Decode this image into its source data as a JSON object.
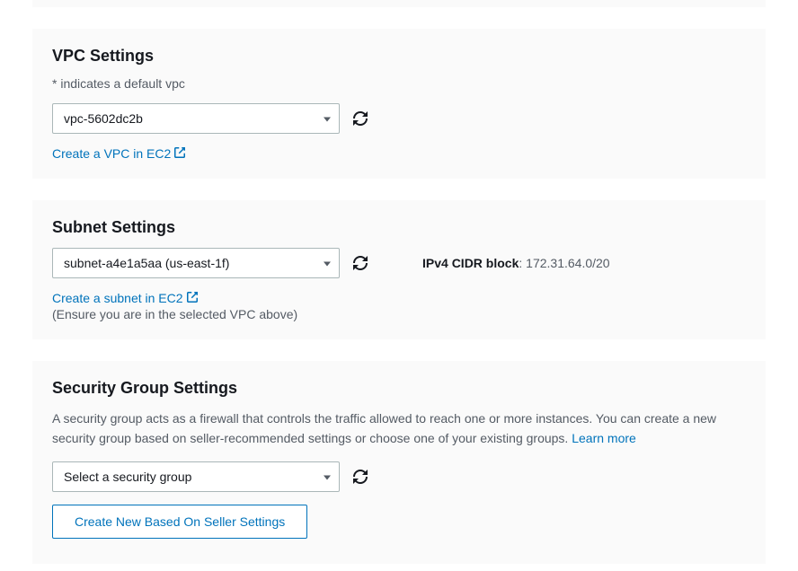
{
  "vpc": {
    "title": "VPC Settings",
    "hint": "* indicates a default vpc",
    "selected": "vpc-5602dc2b",
    "create_link": "Create a VPC in EC2"
  },
  "subnet": {
    "title": "Subnet Settings",
    "selected": "subnet-a4e1a5aa (us-east-1f)",
    "cidr_label": "IPv4 CIDR block",
    "cidr_value": "172.31.64.0/20",
    "create_link": "Create a subnet in EC2",
    "note": "(Ensure you are in the selected VPC above)"
  },
  "sg": {
    "title": "Security Group Settings",
    "description_pre": "A security group acts as a firewall that controls the traffic allowed to reach one or more instances. You can create a new security group based on seller-recommended settings or choose one of your existing groups. ",
    "learn_more": "Learn more",
    "selected": "Select a security group",
    "create_button": "Create New Based On Seller Settings"
  }
}
